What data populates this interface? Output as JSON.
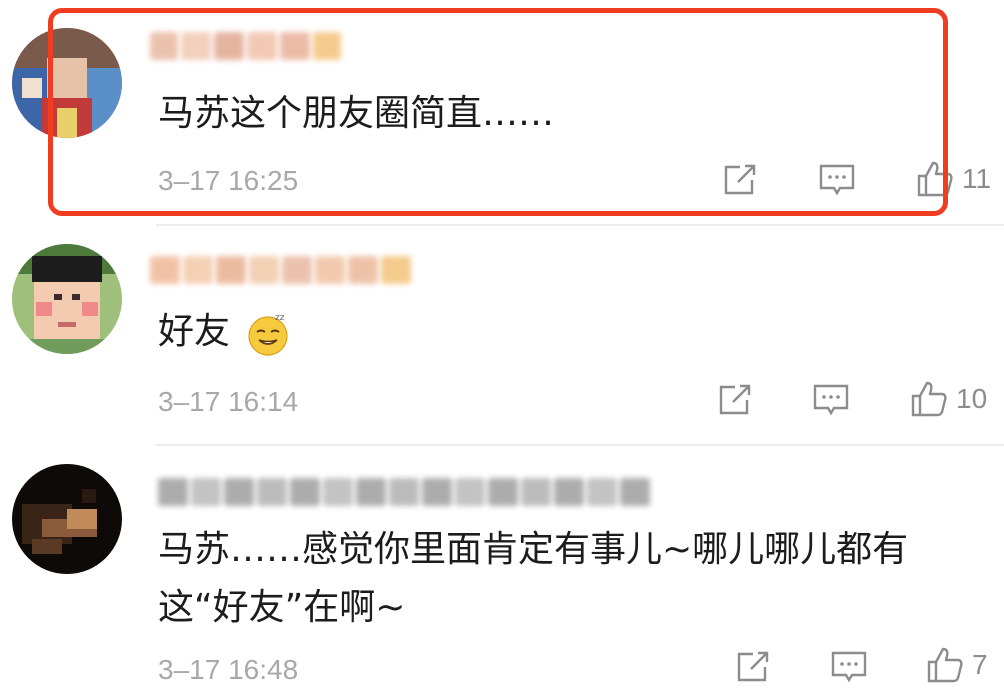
{
  "comments": [
    {
      "text": "马苏这个朋友圈简直……",
      "time": "3–17 16:25",
      "likes": "11",
      "highlighted": true
    },
    {
      "text": "好友",
      "time": "3–17 16:14",
      "likes": "10",
      "emoji": "sweat-smile-emoji"
    },
    {
      "text_line1": "马苏……感觉你里面肯定有事儿~哪儿哪儿都有",
      "text_line2": "这“好友”在啊~",
      "time": "3–17 16:48",
      "likes": "7"
    }
  ],
  "icons": {
    "share": "share-icon",
    "reply": "comment-icon",
    "like": "thumbs-up-icon"
  },
  "colors": {
    "highlight": "#f13d1f",
    "meta": "#a8a8a8",
    "text": "#1c1c1c"
  }
}
